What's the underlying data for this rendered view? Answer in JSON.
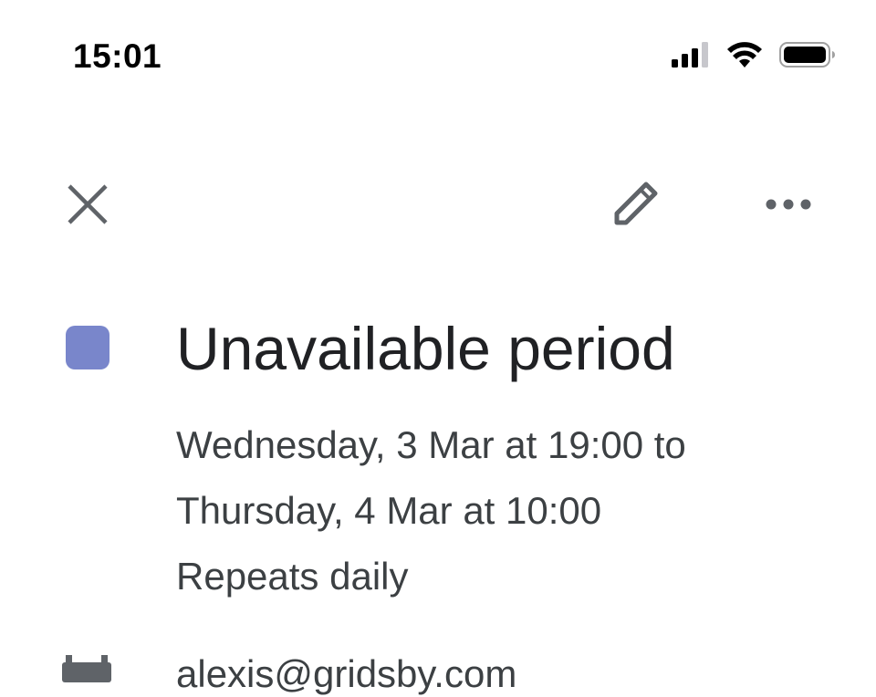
{
  "status_bar": {
    "time": "15:01",
    "icons": [
      "cellular-signal-icon",
      "wifi-icon",
      "battery-icon"
    ]
  },
  "toolbar": {
    "icons": [
      "close-icon",
      "edit-icon",
      "more-icon"
    ]
  },
  "event": {
    "color": "#7986cb",
    "title": "Unavailable period",
    "when_line1": "Wednesday, 3 Mar at 19:00 to",
    "when_line2": "Thursday, 4 Mar at 10:00",
    "recurrence": "Repeats daily"
  },
  "details": {
    "calendar_icon": "calendar-icon",
    "calendar_name_partial": "alexis@gridsby.com"
  },
  "colors": {
    "icon_gray": "#5f6368",
    "text_primary": "#202124",
    "text_secondary": "#3c4043"
  }
}
